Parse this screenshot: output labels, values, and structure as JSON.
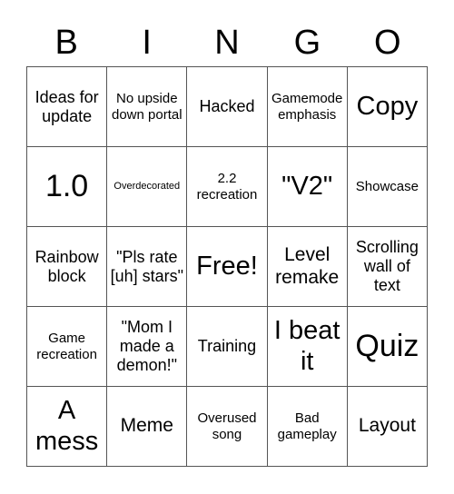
{
  "header": {
    "letters": [
      "B",
      "I",
      "N",
      "G",
      "O"
    ]
  },
  "cells": [
    {
      "text": "Ideas for update",
      "size": "s-md"
    },
    {
      "text": "No upside down portal",
      "size": "s-sm"
    },
    {
      "text": "Hacked",
      "size": "s-md"
    },
    {
      "text": "Gamemode emphasis",
      "size": "s-sm"
    },
    {
      "text": "Copy",
      "size": "s-xl"
    },
    {
      "text": "1.0",
      "size": "s-xxl"
    },
    {
      "text": "Overdecorated",
      "size": "s-xs"
    },
    {
      "text": "2.2 recreation",
      "size": "s-sm"
    },
    {
      "text": "\"V2\"",
      "size": "s-xl"
    },
    {
      "text": "Showcase",
      "size": "s-sm"
    },
    {
      "text": "Rainbow block",
      "size": "s-md"
    },
    {
      "text": "\"Pls rate [uh] stars\"",
      "size": "s-md"
    },
    {
      "text": "Free!",
      "size": "s-xl"
    },
    {
      "text": "Level remake",
      "size": "s-lg"
    },
    {
      "text": "Scrolling wall of text",
      "size": "s-md"
    },
    {
      "text": "Game recreation",
      "size": "s-sm"
    },
    {
      "text": "\"Mom I made a demon!\"",
      "size": "s-md"
    },
    {
      "text": "Training",
      "size": "s-md"
    },
    {
      "text": "I beat it",
      "size": "s-xl"
    },
    {
      "text": "Quiz",
      "size": "s-xxl"
    },
    {
      "text": "A mess",
      "size": "s-xl"
    },
    {
      "text": "Meme",
      "size": "s-lg"
    },
    {
      "text": "Overused song",
      "size": "s-sm"
    },
    {
      "text": "Bad gameplay",
      "size": "s-sm"
    },
    {
      "text": "Layout",
      "size": "s-lg"
    }
  ]
}
